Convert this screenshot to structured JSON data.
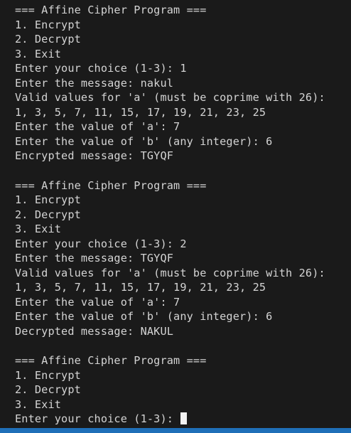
{
  "terminal": {
    "blocks": [
      {
        "lines": [
          "=== Affine Cipher Program ===",
          "1. Encrypt",
          "2. Decrypt",
          "3. Exit",
          "Enter your choice (1-3): 1",
          "Enter the message: nakul",
          "Valid values for 'a' (must be coprime with 26):",
          "1, 3, 5, 7, 11, 15, 17, 19, 21, 23, 25",
          "Enter the value of 'a': 7",
          "Enter the value of 'b' (any integer): 6",
          "Encrypted message: TGYQF"
        ]
      },
      {
        "lines": [
          "=== Affine Cipher Program ===",
          "1. Encrypt",
          "2. Decrypt",
          "3. Exit",
          "Enter your choice (1-3): 2",
          "Enter the message: TGYQF",
          "Valid values for 'a' (must be coprime with 26):",
          "1, 3, 5, 7, 11, 15, 17, 19, 21, 23, 25",
          "Enter the value of 'a': 7",
          "Enter the value of 'b' (any integer): 6",
          "Decrypted message: NAKUL"
        ]
      },
      {
        "lines": [
          "=== Affine Cipher Program ===",
          "1. Encrypt",
          "2. Decrypt",
          "3. Exit"
        ]
      }
    ],
    "prompt": "Enter your choice (1-3): ",
    "colors": {
      "background": "#1a1a1a",
      "text": "#d4d4d4",
      "cursor": "#f2f2f2",
      "status_bar": "#1f6fb8"
    }
  }
}
